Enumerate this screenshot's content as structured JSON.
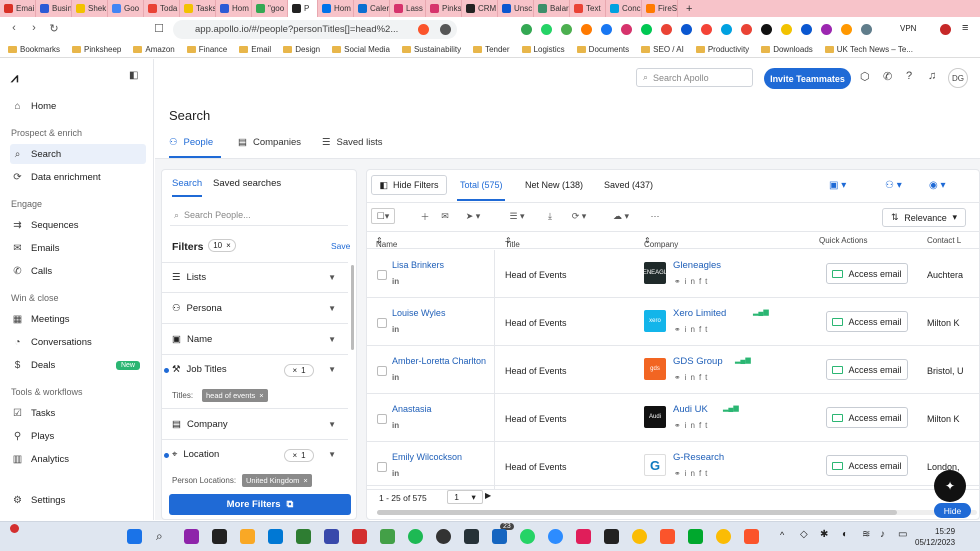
{
  "browser": {
    "tabs": [
      {
        "label": "Emai",
        "color": "#d93025"
      },
      {
        "label": "Busin",
        "color": "#2c5bd6"
      },
      {
        "label": "Shek",
        "color": "#f2c200"
      },
      {
        "label": "Goo",
        "color": "#4285f4"
      },
      {
        "label": "Toda",
        "color": "#e94235"
      },
      {
        "label": "Tasks",
        "color": "#f2c200"
      },
      {
        "label": "Hom",
        "color": "#2c5bd6"
      },
      {
        "label": "\"goo",
        "color": "#34a853"
      },
      {
        "label": "P",
        "color": "#222222"
      },
      {
        "label": "Hom",
        "color": "#0073ea"
      },
      {
        "label": "Caler",
        "color": "#0b6fd1"
      },
      {
        "label": "Lass",
        "color": "#d6336c"
      },
      {
        "label": "Pinks",
        "color": "#d6336c"
      },
      {
        "label": "CRM",
        "color": "#222222"
      },
      {
        "label": "Unsc",
        "color": "#0b57d0"
      },
      {
        "label": "Balar",
        "color": "#3c8f6a"
      },
      {
        "label": "Text",
        "color": "#ea4335"
      },
      {
        "label": "Conc",
        "color": "#00a1e0"
      },
      {
        "label": "FireS",
        "color": "#ff7a00"
      }
    ],
    "url": "app.apollo.io/#/people?personTitles[]=head%2...",
    "vpn": "VPN",
    "bookmarks": [
      "Bookmarks",
      "Pinksheep",
      "Amazon",
      "Finance",
      "Email",
      "Design",
      "Social Media",
      "Sustainability",
      "Tender",
      "Logistics",
      "Documents",
      "SEO / AI",
      "Productivity",
      "Downloads",
      "UK Tech News – Te..."
    ]
  },
  "sidebar": {
    "home": "Home",
    "section1": "Prospect & enrich",
    "search": "Search",
    "enrichment": "Data enrichment",
    "section2": "Engage",
    "sequences": "Sequences",
    "emails": "Emails",
    "calls": "Calls",
    "section3": "Win & close",
    "meetings": "Meetings",
    "conversations": "Conversations",
    "deals": "Deals",
    "new_badge": "New",
    "section4": "Tools & workflows",
    "tasks": "Tasks",
    "plays": "Plays",
    "analytics": "Analytics",
    "settings": "Settings"
  },
  "topbar": {
    "search_placeholder": "Search Apollo",
    "invite": "Invite Teammates",
    "avatar": "DG"
  },
  "page": {
    "title": "Search",
    "tabs": [
      "People",
      "Companies",
      "Saved lists"
    ]
  },
  "filters": {
    "tab_search": "Search",
    "tab_saved": "Saved searches",
    "search_placeholder": "Search People...",
    "heading": "Filters",
    "count": "10",
    "save": "Save",
    "lists": "Lists",
    "persona": "Persona",
    "name": "Name",
    "job_titles": "Job Titles",
    "job_titles_count": "1",
    "titles_label": "Titles:",
    "title_chip": "head of events",
    "company": "Company",
    "location": "Location",
    "location_count": "1",
    "location_label": "Person Locations:",
    "location_chip": "United Kingdom",
    "more": "More Filters"
  },
  "results": {
    "hide_filters": "Hide Filters",
    "tab_total": "Total (575)",
    "tab_new": "Net New (138)",
    "tab_saved": "Saved (437)",
    "sort": "Relevance",
    "columns": [
      "Name",
      "Title",
      "Company",
      "Quick Actions",
      "Contact L"
    ],
    "rows": [
      {
        "name": "Lisa Brinkers",
        "title": "Head of Events",
        "company": "Gleneagles",
        "logo_text": "GLENEAGLES",
        "logo_color": "#1f2a2a",
        "signal": "",
        "action": "Access email",
        "location": "Auchtera"
      },
      {
        "name": "Louise Wyles",
        "title": "Head of Events",
        "company": "Xero Limited",
        "logo_text": "xero",
        "logo_color": "#13b5ea",
        "signal": "▂▄▆",
        "action": "Access email",
        "location": "Milton K"
      },
      {
        "name": "Amber-Loretta Charlton",
        "title": "Head of Events",
        "company": "GDS Group",
        "logo_text": "gds",
        "logo_color": "#f26522",
        "signal": "▂▄▆",
        "action": "Access email",
        "location": "Bristol, U"
      },
      {
        "name": "Anastasia",
        "title": "Head of Events",
        "company": "Audi UK",
        "logo_text": "Audi",
        "logo_color": "#111111",
        "signal": "▂▄▆",
        "action": "Access email",
        "location": "Milton K"
      },
      {
        "name": "Emily Wilcockson",
        "title": "Head of Events",
        "company": "G-Research",
        "logo_text": "G",
        "logo_color": "#ffffff",
        "signal": "",
        "action": "Access email",
        "location": "London,"
      }
    ],
    "pager_text": "1 - 25 of 575",
    "page": "1"
  },
  "widgets": {
    "hide": "Hide"
  },
  "taskbar": {
    "time": "15:29",
    "date": "05/12/2023",
    "badge": "23"
  }
}
